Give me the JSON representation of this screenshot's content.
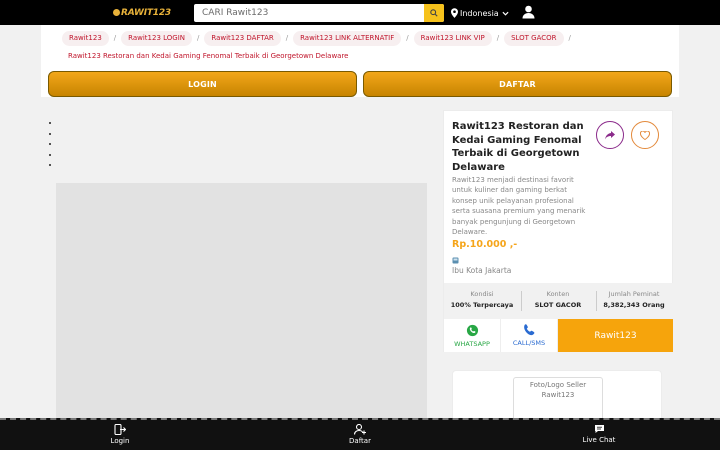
{
  "header": {
    "logo_text": "RAWIT123",
    "search_placeholder": "CARI Rawit123",
    "language": "Indonesia"
  },
  "breadcrumbs": [
    "Rawit123",
    "Rawit123 LOGIN",
    "Rawit123 DAFTAR",
    "Rawit123 LINK ALTERNATIF",
    "Rawit123 LINK VIP",
    "SLOT GACOR",
    "Rawit123 Restoran dan Kedai Gaming Fenomal Terbaik di Georgetown Delaware"
  ],
  "buttons": {
    "login": "LOGIN",
    "daftar": "DAFTAR"
  },
  "product": {
    "title": "Rawit123 Restoran dan Kedai Gaming Fenomal Terbaik di Georgetown Delaware",
    "description": "Rawit123 menjadi destinasi favorit untuk kuliner dan gaming berkat konsep unik pelayanan profesional serta suasana premium yang menarik banyak pengunjung di Georgetown Delaware.",
    "price": "Rp.10.000 ,-",
    "location": "Ibu Kota Jakarta"
  },
  "stats": [
    {
      "label": "Kondisi",
      "value": "100% Terpercaya"
    },
    {
      "label": "Konten",
      "value": "SLOT GACOR"
    },
    {
      "label": "Jumlah Peminat",
      "value": "8,382,343 Orang"
    }
  ],
  "actions": {
    "whatsapp": "WHATSAPP",
    "call": "CALL/SMS",
    "main": "Rawit123"
  },
  "seller": {
    "image_alt": "Foto/Logo Seller Rawit123"
  },
  "bottom_nav": {
    "login": "Login",
    "daftar": "Daftar",
    "chat": "Live Chat"
  },
  "colors": {
    "accent": "#f6a40c",
    "brand_gold": "#e8b23a",
    "crumb_red": "#c0152b",
    "whatsapp": "#28a745",
    "call": "#2a6bd1"
  }
}
